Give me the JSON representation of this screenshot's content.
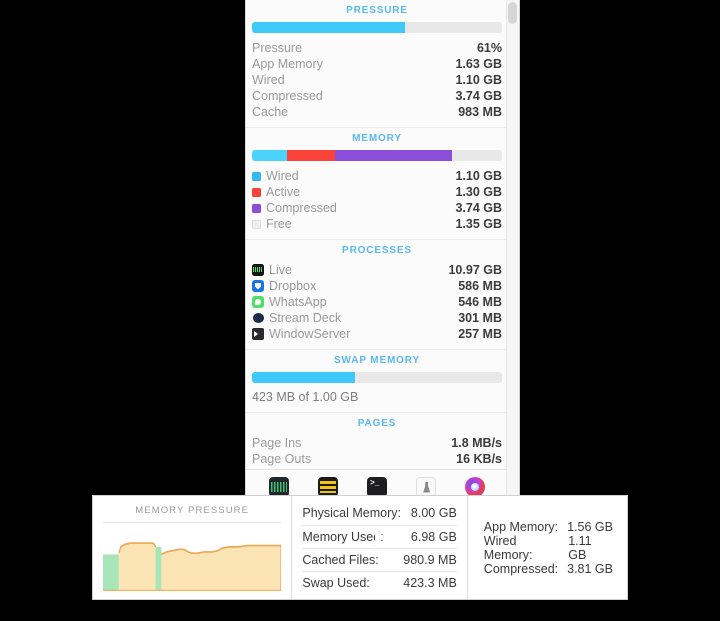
{
  "panel": {
    "sections": [
      {
        "title": "PRESSURE",
        "bar": {
          "type": "single",
          "percent": 61,
          "color": "#3fc9fa",
          "track": "#e8e8e8"
        },
        "rows": [
          {
            "label": "Pressure",
            "value": "61%"
          },
          {
            "label": "App Memory",
            "value": "1.63 GB"
          },
          {
            "label": "Wired",
            "value": "1.10 GB"
          },
          {
            "label": "Compressed",
            "value": "3.74 GB"
          },
          {
            "label": "Cache",
            "value": "983 MB"
          }
        ]
      },
      {
        "title": "MEMORY",
        "bar": {
          "type": "stacked",
          "segments": [
            {
              "name": "Wired",
              "percent": 14,
              "color": "#4ad4fb"
            },
            {
              "name": "Active",
              "percent": 19,
              "color": "#fb4238"
            },
            {
              "name": "Compressed",
              "percent": 47,
              "color": "#8b4fdc"
            },
            {
              "name": "Free",
              "percent": 20,
              "color": "#e8e8e8"
            }
          ]
        },
        "rows": [
          {
            "label": "Wired",
            "value": "1.10 GB",
            "swatch": "#34b7f5"
          },
          {
            "label": "Active",
            "value": "1.30 GB",
            "swatch": "#fb4238"
          },
          {
            "label": "Compressed",
            "value": "3.74 GB",
            "swatch": "#8b4fdc"
          },
          {
            "label": "Free",
            "value": "1.35 GB",
            "swatch": "#eeeeee"
          }
        ]
      },
      {
        "title": "PROCESSES",
        "rows": [
          {
            "label": "Live",
            "value": "10.97 GB",
            "icon": "live-app-icon"
          },
          {
            "label": "Dropbox",
            "value": "586 MB",
            "icon": "dropbox-app-icon"
          },
          {
            "label": "WhatsApp",
            "value": "546 MB",
            "icon": "whatsapp-app-icon"
          },
          {
            "label": "Stream Deck",
            "value": "301 MB",
            "icon": "stream-deck-app-icon"
          },
          {
            "label": "WindowServer",
            "value": "257 MB",
            "icon": "windowserver-app-icon"
          }
        ]
      },
      {
        "title": "SWAP MEMORY",
        "bar": {
          "type": "single",
          "percent": 41,
          "color": "#3fc9fa",
          "track": "#e8e8e8"
        },
        "caption": "423 MB of 1.00 GB"
      },
      {
        "title": "PAGES",
        "rows": [
          {
            "label": "Page Ins",
            "value": "1.8 MB/s"
          },
          {
            "label": "Page Outs",
            "value": "16 KB/s"
          }
        ]
      }
    ],
    "toolbar": [
      {
        "name": "activity-monitor-icon",
        "label": "Activity Monitor"
      },
      {
        "name": "stats-display-icon",
        "label": "Stats"
      },
      {
        "name": "terminal-icon",
        "label": "Terminal"
      },
      {
        "name": "lab-flask-icon",
        "label": "Lab"
      },
      {
        "name": "colorful-app-icon",
        "label": "App"
      }
    ],
    "scrollbar": {
      "name": "panel-scrollbar"
    }
  },
  "bottom_panel": {
    "chart_title": "MEMORY PRESSURE",
    "stats": [
      {
        "label": "Physical Memory:",
        "value": "8.00 GB"
      },
      {
        "label": "Memory Used:",
        "value": "6.98 GB"
      },
      {
        "label": "Cached Files:",
        "value": "980.9 MB"
      },
      {
        "label": "Swap Used:",
        "value": "423.3 MB"
      }
    ],
    "extra": [
      {
        "label": "App Memory:",
        "value": "1.56 GB"
      },
      {
        "label": "Wired Memory:",
        "value": "1.11 GB"
      },
      {
        "label": "Compressed:",
        "value": "3.81 GB"
      }
    ]
  },
  "chart_data": {
    "type": "area",
    "title": "MEMORY PRESSURE",
    "xlabel": "",
    "ylabel": "",
    "ylim": [
      0,
      100
    ],
    "grid": false,
    "legend": "none",
    "series": [
      {
        "name": "Memory Pressure",
        "fill_color": "#fbe5b4",
        "line_color": "#f0a552",
        "values": [
          38,
          39,
          39,
          62,
          74,
          76,
          76,
          76,
          76,
          76,
          76,
          76,
          76,
          76,
          76,
          75,
          74,
          46,
          45,
          66,
          67,
          68,
          68,
          69,
          70,
          70,
          71,
          69,
          65,
          65,
          65,
          66,
          67,
          67,
          67,
          68,
          68,
          67,
          66,
          66,
          66,
          67,
          68,
          70,
          71,
          71,
          72,
          72,
          72,
          72,
          72,
          73,
          73,
          73,
          73,
          73,
          73,
          73,
          73,
          73
        ]
      }
    ],
    "green_bands": [
      {
        "start_pct": 0,
        "end_pct": 9,
        "color": "#a8e6b8",
        "value": 52
      },
      {
        "start_pct": 29.5,
        "end_pct": 33,
        "color": "#a8e6b8",
        "value": 66
      }
    ],
    "notes": "Green regions indicate normal pressure; orange/tan region indicates elevated memory pressure."
  }
}
